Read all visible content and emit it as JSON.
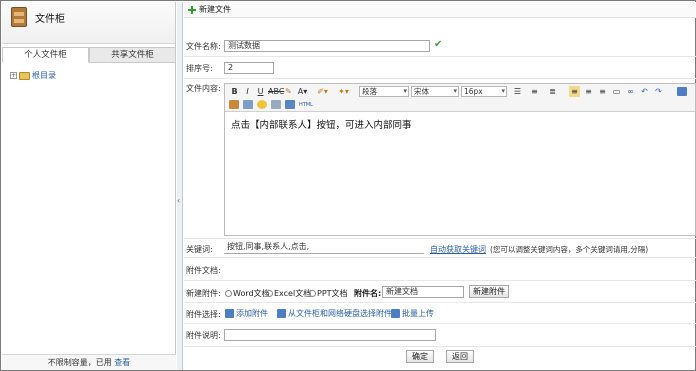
{
  "left": {
    "title": "文件柜",
    "tabs": [
      "个人文件柜",
      "共享文件柜"
    ],
    "tree_root": "根目录",
    "footer_text": "不限制容量，已用",
    "footer_link": "查看"
  },
  "form": {
    "header": "新建文件",
    "labels": {
      "name": "文件名称:",
      "order": "排序号:",
      "content": "文件内容:",
      "keywords": "关键词:",
      "attachments_doc": "附件文档:",
      "new_attachment": "新建附件:",
      "attachment_select": "附件选择:",
      "attachment_desc": "附件说明:"
    },
    "name_value": "测试数据",
    "order_value": "2",
    "content_text": "点击【内部联系人】按钮，可进入内部同事",
    "keywords_value": "按钮,同事,联系人,点击,",
    "auto_keywords_link": "自动获取关键词",
    "keywords_hint": "(您可以调整关键词内容，多个关键词请用,分隔)",
    "new_attachment_options": [
      "Word文档",
      "Excel文档",
      "PPT文档"
    ],
    "attachment_name_label": "附件名:",
    "attachment_name_value": "新建文档",
    "new_attachment_button": "新建附件",
    "attach_actions": [
      "添加附件",
      "从文件柜和网络硬盘选择附件",
      "批量上传"
    ],
    "confirm_button": "确定",
    "back_button": "返回"
  },
  "toolbar": {
    "format_select": "段落",
    "font_select": "宋体",
    "size_select": "16px"
  }
}
